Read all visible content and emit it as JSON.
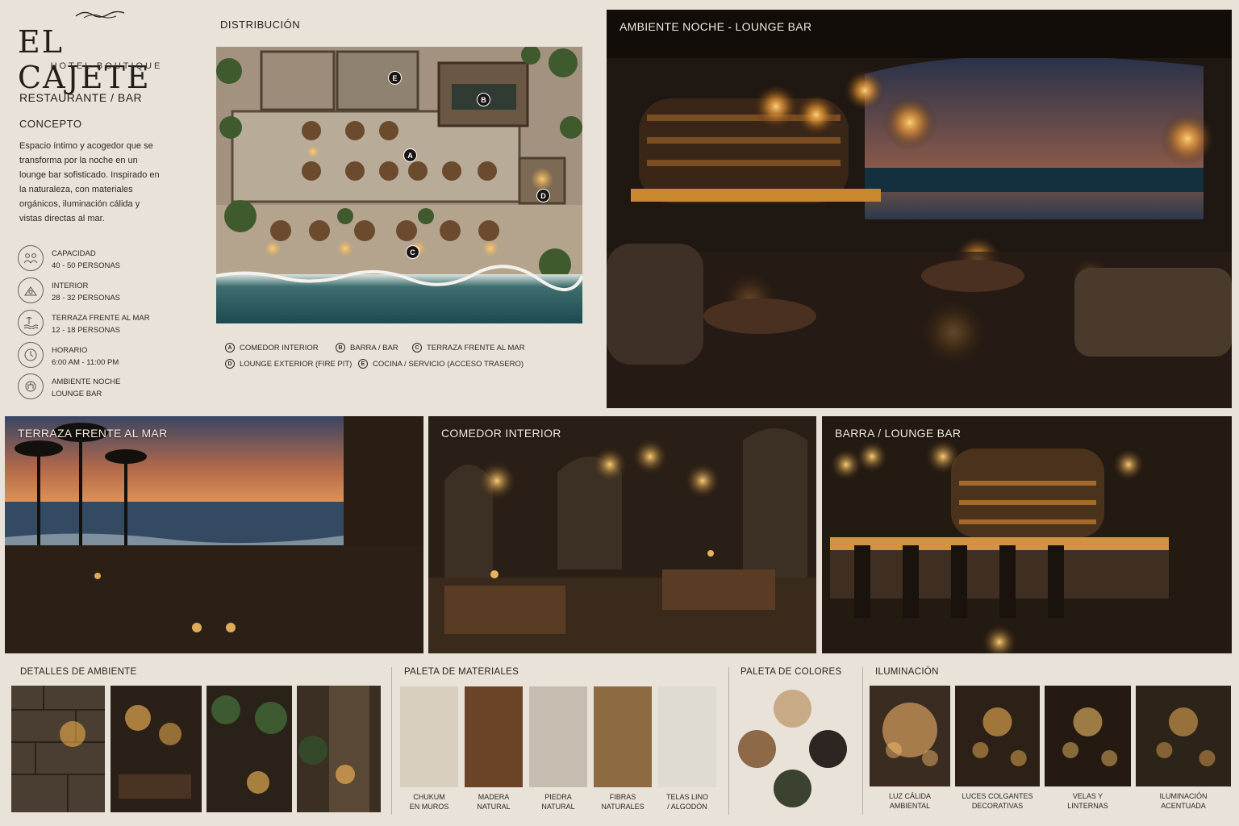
{
  "brand": {
    "name": "EL CAJETE",
    "tagline": "HOTEL BOUTIQUE"
  },
  "section": {
    "title": "RESTAURANTE / BAR",
    "concept_title": "CONCEPTO",
    "concept_text": "Espacio íntimo y acogedor que se transforma por la noche en un lounge bar sofisticado. Inspirado en la naturaleza, con materiales orgánicos, iluminación cálida y vistas directas al mar."
  },
  "specs": [
    {
      "icon": "people-icon",
      "label": "CAPACIDAD",
      "value": "40 - 50 PERSONAS"
    },
    {
      "icon": "interior-icon",
      "label": "INTERIOR",
      "value": "28 - 32 PERSONAS"
    },
    {
      "icon": "sea-terrace-icon",
      "label": "TERRAZA FRENTE AL MAR",
      "value": "12 - 18 PERSONAS"
    },
    {
      "icon": "clock-icon",
      "label": "HORARIO",
      "value": "6:00 AM - 11:00 PM"
    },
    {
      "icon": "lounge-icon",
      "label": "AMBIENTE NOCHE",
      "value": "LOUNGE BAR"
    }
  ],
  "plan": {
    "title": "DISTRIBUCIÓN",
    "markers": [
      "A",
      "B",
      "C",
      "D",
      "E"
    ],
    "legend": [
      {
        "key": "A",
        "label": "COMEDOR INTERIOR"
      },
      {
        "key": "B",
        "label": "BARRA / BAR"
      },
      {
        "key": "C",
        "label": "TERRAZA FRENTE AL MAR"
      },
      {
        "key": "D",
        "label": "LOUNGE EXTERIOR (FIRE PIT)"
      },
      {
        "key": "E",
        "label": "COCINA / SERVICIO (ACCESO TRASERO)"
      }
    ]
  },
  "photos": {
    "main": "AMBIENTE NOCHE - LOUNGE BAR",
    "terrace": "TERRAZA FRENTE AL MAR",
    "dining": "COMEDOR INTERIOR",
    "bar": "BARRA / LOUNGE BAR"
  },
  "details": {
    "title": "DETALLES DE AMBIENTE"
  },
  "materials": {
    "title": "PALETA DE MATERIALES",
    "items": [
      {
        "l1": "CHUKUM",
        "l2": "EN MUROS",
        "color": "#d9cfc0"
      },
      {
        "l1": "MADERA",
        "l2": "NATURAL",
        "color": "#6b4427"
      },
      {
        "l1": "PIEDRA",
        "l2": "NATURAL",
        "color": "#c5bdb0"
      },
      {
        "l1": "FIBRAS",
        "l2": "NATURALES",
        "color": "#8e6a43"
      },
      {
        "l1": "TELAS LINO",
        "l2": "/ ALGODÓN",
        "color": "#e0dbd2"
      }
    ]
  },
  "colors": {
    "title": "PALETA DE COLORES",
    "swatches": [
      "#c8ab86",
      "#8e6947",
      "#2c2521",
      "#3b4230"
    ]
  },
  "lighting": {
    "title": "ILUMINACIÓN",
    "items": [
      {
        "l1": "LUZ CÁLIDA",
        "l2": "AMBIENTAL"
      },
      {
        "l1": "LUCES COLGANTES",
        "l2": "DECORATIVAS"
      },
      {
        "l1": "VELAS Y",
        "l2": "LINTERNAS"
      },
      {
        "l1": "ILUMINACIÓN",
        "l2": "ACENTUADA"
      }
    ]
  }
}
